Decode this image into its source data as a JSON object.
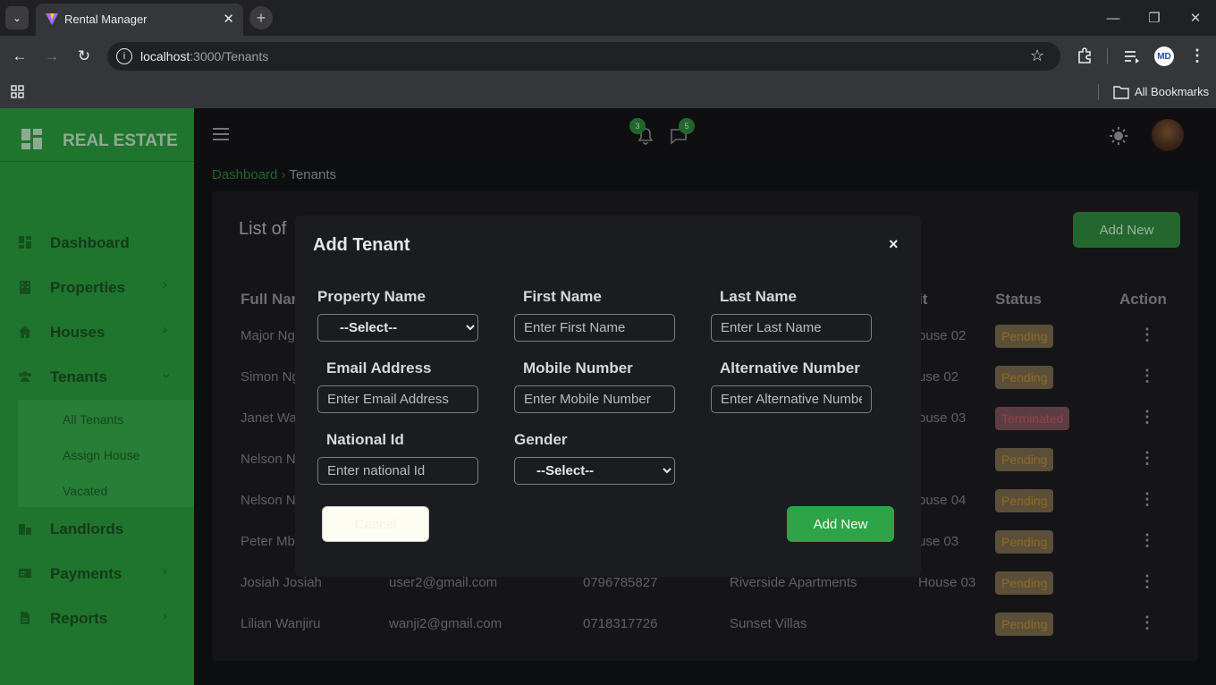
{
  "browser": {
    "tab_title": "Rental Manager",
    "url_host": "localhost",
    "url_path": ":3000/Tenants",
    "bookmarks_label": "All Bookmarks",
    "profile_initials": "MD"
  },
  "sidebar": {
    "brand": "REAL ESTATE",
    "items": [
      {
        "label": "Dashboard",
        "icon": "dashboard-icon"
      },
      {
        "label": "Properties",
        "icon": "building-icon"
      },
      {
        "label": "Houses",
        "icon": "home-icon"
      },
      {
        "label": "Tenants",
        "icon": "users-icon"
      },
      {
        "label": "Landlords",
        "icon": "city-icon"
      },
      {
        "label": "Payments",
        "icon": "credit-card-icon"
      },
      {
        "label": "Reports",
        "icon": "file-icon"
      }
    ],
    "submenu": [
      "All Tenants",
      "Assign House",
      "Vacated"
    ]
  },
  "topbar": {
    "notifications_count": "3",
    "messages_count": "5"
  },
  "breadcrumb": {
    "home": "Dashboard",
    "current": "Tenants"
  },
  "card": {
    "title": "List of",
    "add_button": "Add New",
    "headers": [
      "Full Nam",
      "it",
      "Status",
      "Action"
    ],
    "rows": [
      {
        "name": "Major Ng",
        "email": "",
        "phone": "",
        "property": "",
        "unit": "ouse 02",
        "status": "Pending"
      },
      {
        "name": "Simon Ng",
        "email": "",
        "phone": "",
        "property": "",
        "unit": "use 02",
        "status": "Pending"
      },
      {
        "name": "Janet Wa",
        "email": "",
        "phone": "",
        "property": "",
        "unit": "ouse 03",
        "status": "Terminated"
      },
      {
        "name": "Nelson N",
        "email": "",
        "phone": "",
        "property": "",
        "unit": "",
        "status": "Pending"
      },
      {
        "name": "Nelson N",
        "email": "",
        "phone": "",
        "property": "",
        "unit": "ouse 04",
        "status": "Pending"
      },
      {
        "name": "Peter Mb",
        "email": "",
        "phone": "",
        "property": "",
        "unit": "use 03",
        "status": "Pending"
      },
      {
        "name": "Josiah Josiah",
        "email": "user2@gmail.com",
        "phone": "0796785827",
        "property": "Riverside Apartments",
        "unit": "House 03",
        "status": "Pending"
      },
      {
        "name": "Lilian Wanjiru",
        "email": "wanji2@gmail.com",
        "phone": "0718317726",
        "property": "Sunset Villas",
        "unit": "",
        "status": "Pending"
      }
    ]
  },
  "modal": {
    "title": "Add Tenant",
    "close": "×",
    "fields": {
      "property_name": {
        "label": "Property Name",
        "value": "--Select--"
      },
      "first_name": {
        "label": "First Name",
        "placeholder": "Enter First Name"
      },
      "last_name": {
        "label": "Last Name",
        "placeholder": "Enter Last Name"
      },
      "email": {
        "label": "Email Address",
        "placeholder": "Enter Email Address"
      },
      "mobile": {
        "label": "Mobile Number",
        "placeholder": "Enter Mobile Number"
      },
      "alt_number": {
        "label": "Alternative Number",
        "placeholder": "Enter Alternative Number"
      },
      "national_id": {
        "label": "National Id",
        "placeholder": "Enter national Id"
      },
      "gender": {
        "label": "Gender",
        "value": "--Select--"
      }
    },
    "cancel_label": "Cancel",
    "submit_label": "Add New"
  },
  "colors": {
    "sidebar": "#2a9d3d",
    "accent": "#2ea449",
    "pending": "#c18f2d",
    "terminated": "#c3576a"
  }
}
